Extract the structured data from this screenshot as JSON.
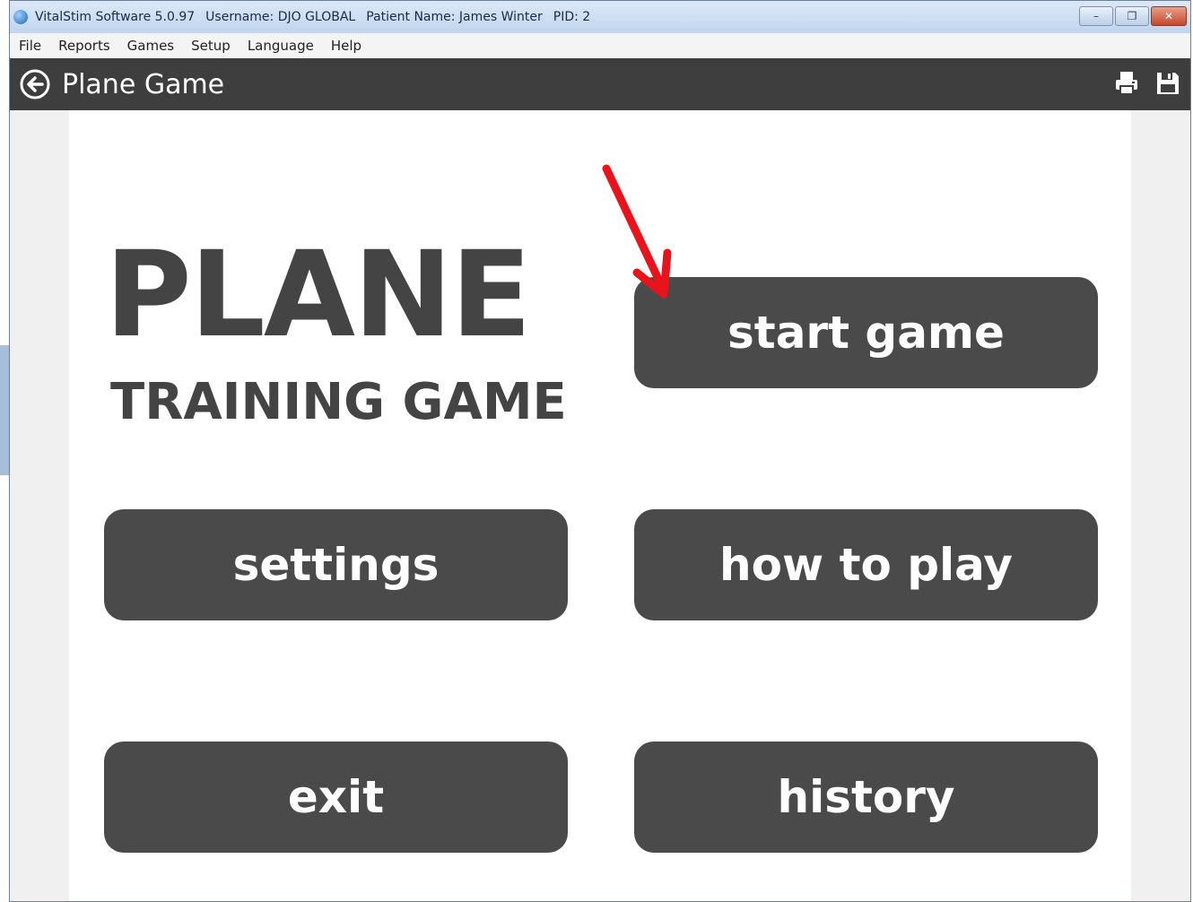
{
  "window": {
    "title_segments": [
      "VitalStim Software 5.0.97",
      "Username: DJO GLOBAL",
      "Patient Name: James Winter",
      "PID: 2"
    ],
    "controls": {
      "minimize": "–",
      "restore": "❐",
      "close": "✕"
    }
  },
  "menu": {
    "items": [
      "File",
      "Reports",
      "Games",
      "Setup",
      "Language",
      "Help"
    ]
  },
  "header": {
    "title": "Plane Game",
    "icons": [
      "back-arrow-icon",
      "printer-icon",
      "save-icon"
    ]
  },
  "game": {
    "logo_title": "PLANE",
    "logo_subtitle": "TRAINING GAME",
    "buttons": {
      "start": "start game",
      "settings": "settings",
      "how_to_play": "how to play",
      "exit": "exit",
      "history": "history"
    }
  },
  "annotation": {
    "icon": "red-arrow-icon",
    "color": "#e8131b"
  },
  "colors": {
    "header_bg": "#3e3e3e",
    "button_bg": "#4a4a4a",
    "logo_text": "#444444"
  }
}
